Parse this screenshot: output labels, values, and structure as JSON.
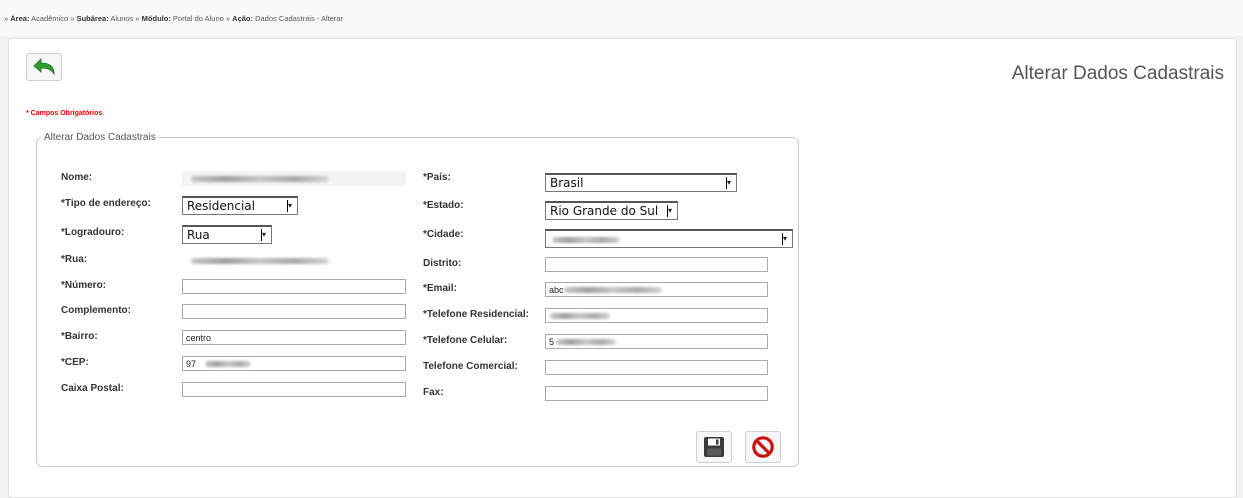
{
  "breadcrumb": {
    "prefix": "»",
    "area_label": "Área:",
    "area_value": "Acadêmico",
    "sep": "»",
    "subarea_label": "Subárea:",
    "subarea_value": "Alunos",
    "modulo_label": "Módulo:",
    "modulo_value": "Portal do Aluno",
    "acao_label": "Ação:",
    "acao_value": "Dados Cadastrais - Alterar"
  },
  "page": {
    "title": "Alterar Dados Cadastrais",
    "required_note": "* Campos Obrigatórios",
    "fieldset_legend": "Alterar Dados Cadastrais"
  },
  "icons": {
    "back": "back-arrow-icon",
    "save": "floppy-disk-icon",
    "cancel": "prohibited-icon"
  },
  "colors": {
    "back_arrow": "#2e9e2e",
    "required": "#ee0000",
    "cancel": "#cc1111"
  },
  "left": {
    "nome_label": "Nome:",
    "tipo_label": "*Tipo de endereço:",
    "tipo_value": "Residencial",
    "logradouro_label": "*Logradouro:",
    "logradouro_value": "Rua",
    "rua_label": "*Rua:",
    "numero_label": "*Número:",
    "numero_value": "",
    "complemento_label": "Complemento:",
    "complemento_value": "",
    "bairro_label": "*Bairro:",
    "bairro_value": "centro",
    "cep_label": "*CEP:",
    "cep_value": "97",
    "caixa_label": "Caixa Postal:",
    "caixa_value": ""
  },
  "right": {
    "pais_label": "*País:",
    "pais_value": "Brasil",
    "estado_label": "*Estado:",
    "estado_value": "Rio Grande do Sul",
    "cidade_label": "*Cidade:",
    "distrito_label": "Distrito:",
    "distrito_value": "",
    "email_label": "*Email:",
    "email_value": "abc",
    "tel_res_label": "*Telefone Residencial:",
    "tel_cel_label": "*Telefone Celular:",
    "tel_cel_value": "5",
    "tel_com_label": "Telefone Comercial:",
    "tel_com_value": "",
    "fax_label": "Fax:",
    "fax_value": ""
  }
}
